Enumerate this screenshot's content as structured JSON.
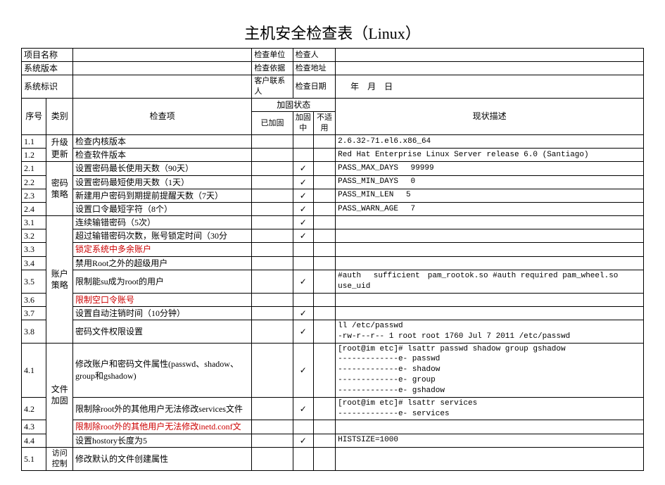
{
  "title": "主机安全检查表（Linux）",
  "header": {
    "projectNameLabel": "项目名称",
    "checkUnitLabel": "检查单位",
    "checkPersonLabel": "检查人",
    "sysVersionLabel": "系统版本",
    "checkAddrLabel": "检查地址",
    "checkBasisLabel": "检查依据",
    "sysIdLabel": "系统标识",
    "clientContactLabel": "客户联系人",
    "checkDateLabel": "检查日期",
    "dateYear": "年",
    "dateMonth": "月",
    "dateDay": "日"
  },
  "cols": {
    "seq": "序号",
    "category": "类别",
    "checkItem": "检查项",
    "hardenStatus": "加固状态",
    "hardened": "已加固",
    "inCheck": "加固中",
    "na": "不适用",
    "desc": "现状描述"
  },
  "checkMark": "✓",
  "cat": {
    "upgrade": "升级\n更新",
    "pwd": "密码\n策略",
    "acct": "账户\n策略",
    "file": "文件\n加固",
    "access": "访问控制"
  },
  "rows": {
    "r1_1": {
      "seq": "1.1",
      "item": "检查内核版本",
      "c1": "",
      "c2": "",
      "c3": "",
      "desc": "2.6.32-71.el6.x86_64"
    },
    "r1_2": {
      "seq": "1.2",
      "item": "检查软件版本",
      "c1": "",
      "c2": "",
      "c3": "",
      "desc": "Red Hat Enterprise Linux Server release 6.0 (Santiago)"
    },
    "r2_1": {
      "seq": "2.1",
      "item": "设置密码最长使用天数（90天）",
      "c1": "",
      "c2": "✓",
      "c3": "",
      "desc": "PASS_MAX_DAYS  99999"
    },
    "r2_2": {
      "seq": "2.2",
      "item": "设置密码最短使用天数（1天）",
      "c1": "",
      "c2": "✓",
      "c3": "",
      "desc": "PASS_MIN_DAYS  0"
    },
    "r2_3": {
      "seq": "2.3",
      "item": "新建用户密码到期提前提醒天数（7天）",
      "c1": "",
      "c2": "✓",
      "c3": "",
      "desc": "PASS_MIN_LEN   5"
    },
    "r2_4": {
      "seq": "2.4",
      "item": "设置口令最短字符（8个）",
      "c1": "",
      "c2": "✓",
      "c3": "",
      "desc": "PASS_WARN_AGE  7"
    },
    "r3_1": {
      "seq": "3.1",
      "item": "连续输错密码（5次）",
      "c1": "",
      "c2": "✓",
      "c3": "",
      "desc": ""
    },
    "r3_2": {
      "seq": "3.2",
      "item": "超过输错密码次数，账号锁定时间（30分",
      "c1": "",
      "c2": "✓",
      "c3": "",
      "desc": ""
    },
    "r3_3": {
      "seq": "3.3",
      "item": "锁定系统中多余账户",
      "c1": "",
      "c2": "",
      "c3": "",
      "desc": ""
    },
    "r3_4": {
      "seq": "3.4",
      "item": "禁用Root之外的超级用户",
      "c1": "",
      "c2": "",
      "c3": "",
      "desc": ""
    },
    "r3_5": {
      "seq": "3.5",
      "item": "限制能su成为root的用户",
      "c1": "",
      "c2": "✓",
      "c3": "",
      "desc": "#auth   sufficient pam_rootok.so #auth required pam_wheel.so use_uid"
    },
    "r3_6": {
      "seq": "3.6",
      "item": "限制空口令账号",
      "c1": "",
      "c2": "",
      "c3": "",
      "desc": ""
    },
    "r3_7": {
      "seq": "3.7",
      "item": "设置自动注销时间（10分钟）",
      "c1": "",
      "c2": "✓",
      "c3": "",
      "desc": ""
    },
    "r3_8": {
      "seq": "3.8",
      "item": "密码文件权限设置",
      "c1": "",
      "c2": "✓",
      "c3": "",
      "desc": "ll /etc/passwd\n-rw-r--r-- 1 root root 1760 Jul  7  2011 /etc/passwd"
    },
    "r4_1": {
      "seq": "4.1",
      "item": "修改账户和密码文件属性(passwd、shadow、group和gshadow)",
      "c1": "",
      "c2": "✓",
      "c3": "",
      "desc": "[root@im etc]# lsattr passwd shadow group gshadow\n-------------e- passwd\n-------------e- shadow\n-------------e- group\n-------------e- gshadow"
    },
    "r4_2": {
      "seq": "4.2",
      "item": "限制除root外的其他用户无法修改services文件",
      "c1": "",
      "c2": "✓",
      "c3": "",
      "desc": "[root@im etc]# lsattr services\n-------------e- services"
    },
    "r4_3": {
      "seq": "4.3",
      "item": "限制除root外的其他用户无法修改inetd.conf文",
      "c1": "",
      "c2": "",
      "c3": "",
      "desc": ""
    },
    "r4_4": {
      "seq": "4.4",
      "item": "设置hostory长度为5",
      "c1": "",
      "c2": "✓",
      "c3": "",
      "desc": "HISTSIZE=1000"
    },
    "r5_1": {
      "seq": "5.1",
      "item": "修改默认的文件创建属性",
      "c1": "",
      "c2": "",
      "c3": "",
      "desc": ""
    }
  }
}
